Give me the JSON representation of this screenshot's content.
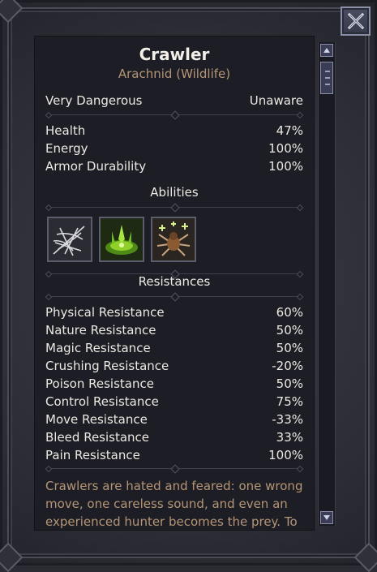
{
  "creature": {
    "name": "Crawler",
    "type": "Arachnid (Wildlife)",
    "danger": "Very Dangerous",
    "awareness": "Unaware"
  },
  "vitals": [
    {
      "label": "Health",
      "value": "47%"
    },
    {
      "label": "Energy",
      "value": "100%"
    },
    {
      "label": "Armor Durability",
      "value": "100%"
    }
  ],
  "abilities": {
    "heading": "Abilities",
    "items": [
      {
        "icon": "web-icon"
      },
      {
        "icon": "poison-pool-icon"
      },
      {
        "icon": "spider-spawn-icon"
      }
    ]
  },
  "resistances": {
    "heading": "Resistances",
    "items": [
      {
        "label": "Physical Resistance",
        "value": "60%"
      },
      {
        "label": "Nature Resistance",
        "value": "50%"
      },
      {
        "label": "Magic Resistance",
        "value": "50%"
      },
      {
        "label": "Crushing Resistance",
        "value": "-20%"
      },
      {
        "label": "Poison Resistance",
        "value": "50%"
      },
      {
        "label": "Control Resistance",
        "value": "75%"
      },
      {
        "label": "Move Resistance",
        "value": "-33%"
      },
      {
        "label": "Bleed Resistance",
        "value": "33%"
      },
      {
        "label": "Pain Resistance",
        "value": "100%"
      }
    ]
  },
  "description": {
    "line1": "Crawlers are hated and feared: one wrong",
    "line2": "move, one careless sound, and even an",
    "line3": "experienced hunter becomes the prey. To"
  },
  "colors": {
    "accent_brown": "#b59576",
    "panel_bg": "#1d1e25",
    "frame_bg": "#2c2d35",
    "button_border": "#8a8ea6"
  }
}
